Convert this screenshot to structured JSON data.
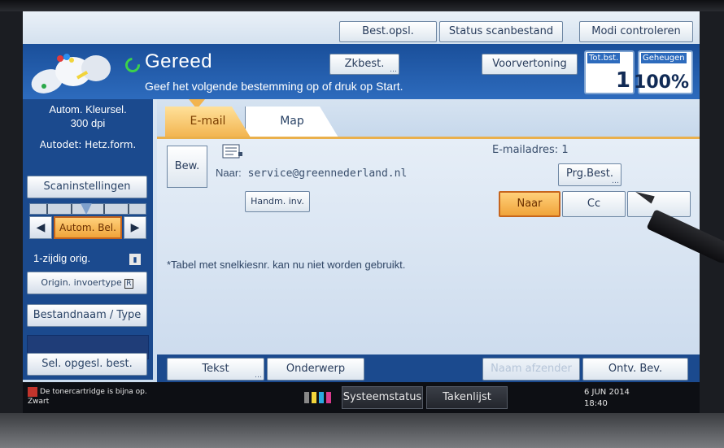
{
  "topbar": {
    "stored_files": "Best.opsl.",
    "scan_status": "Status scanbestand",
    "check_modes": "Modi controleren"
  },
  "header": {
    "status": "Gereed",
    "instruction": "Geef het volgende bestemming op of druk op Start.",
    "search_dest": "Zkbest.",
    "preview": "Voorvertoning",
    "total_dest_caption": "Tot.bst.",
    "total_dest_value": "1",
    "memory_caption": "Geheugen",
    "memory_value": "100%"
  },
  "left_panel": {
    "color_mode_line1": "Autom. Kleursel.",
    "color_mode_line2": "300 dpi",
    "autodetect": "Autodet: Hetz.form.",
    "scan_settings": "Scaninstellingen",
    "density": "Autom. Bel.",
    "original_side": "1-zijdig orig.",
    "original_feed": "Origin. invoertype",
    "file_name_type": "Bestandnaam / Type",
    "select_stored": "Sel. opgesl. best."
  },
  "tabs": [
    {
      "label": "E-mail",
      "active": true
    },
    {
      "label": "Map",
      "active": false
    }
  ],
  "content": {
    "edit_button": "Bew.",
    "to_label": "Naar:",
    "to_address": "service@greennederland.nl",
    "email_count_label": "E-mailadres:",
    "email_count_value": "1",
    "manual_input": "Handm. inv.",
    "program_dest": "Prg.Best.",
    "recipient_to": "Naar",
    "recipient_cc": "Cc",
    "recipient_bcc": "",
    "info_message": "*Tabel met snelkiesnr. kan nu niet worden gebruikt."
  },
  "bottom_buttons": {
    "text": "Tekst",
    "subject": "Onderwerp",
    "sender_name": "Naam afzender",
    "receipt_confirm": "Ontv. Bev."
  },
  "statusbar": {
    "toner_warning": "De tonercartridge is bijna op.",
    "toner_color": "Zwart",
    "system_status": "Systeemstatus",
    "job_list": "Takenlijst",
    "date": "6 JUN  2014",
    "time": "18:40"
  },
  "colors": {
    "header_blue": "#2d6bbd",
    "panel_blue": "#1b4a8e",
    "selected_orange": "#f0a43a",
    "ready_green": "#3cd24a"
  }
}
